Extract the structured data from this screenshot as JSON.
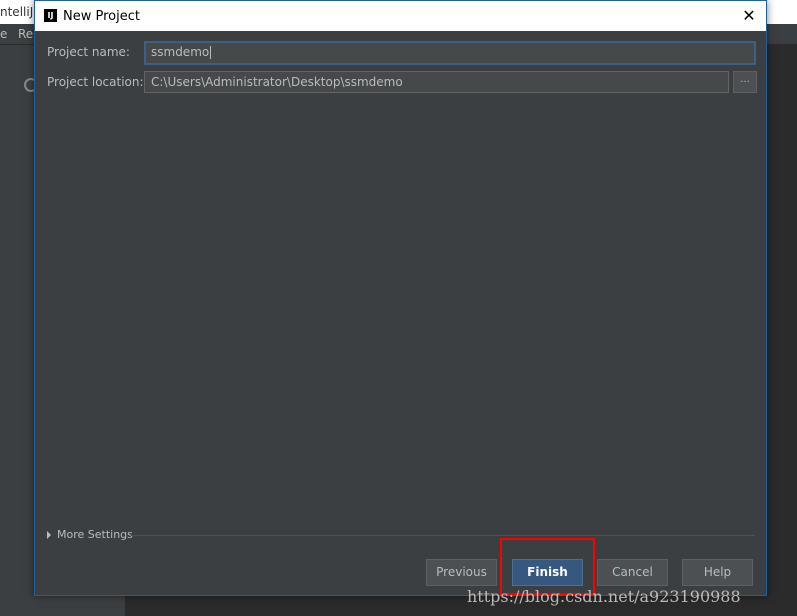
{
  "background": {
    "window_title_fragment": "ntelliJ",
    "menu": [
      "e",
      "Re"
    ]
  },
  "dialog": {
    "title": "New Project",
    "close_glyph": "✕",
    "project_name": {
      "label": "Project name:",
      "value": "ssmdemo"
    },
    "project_location": {
      "label": "Project location:",
      "value": "C:\\Users\\Administrator\\Desktop\\ssmdemo",
      "browse_label": "..."
    },
    "more_settings": "More Settings",
    "buttons": {
      "previous": "Previous",
      "finish": "Finish",
      "cancel": "Cancel",
      "help": "Help"
    }
  },
  "watermark": "https://blog.csdn.net/a923190988",
  "colors": {
    "dialog_bg": "#3c3f41",
    "primary_button": "#365880",
    "highlight": "#ff0000"
  }
}
